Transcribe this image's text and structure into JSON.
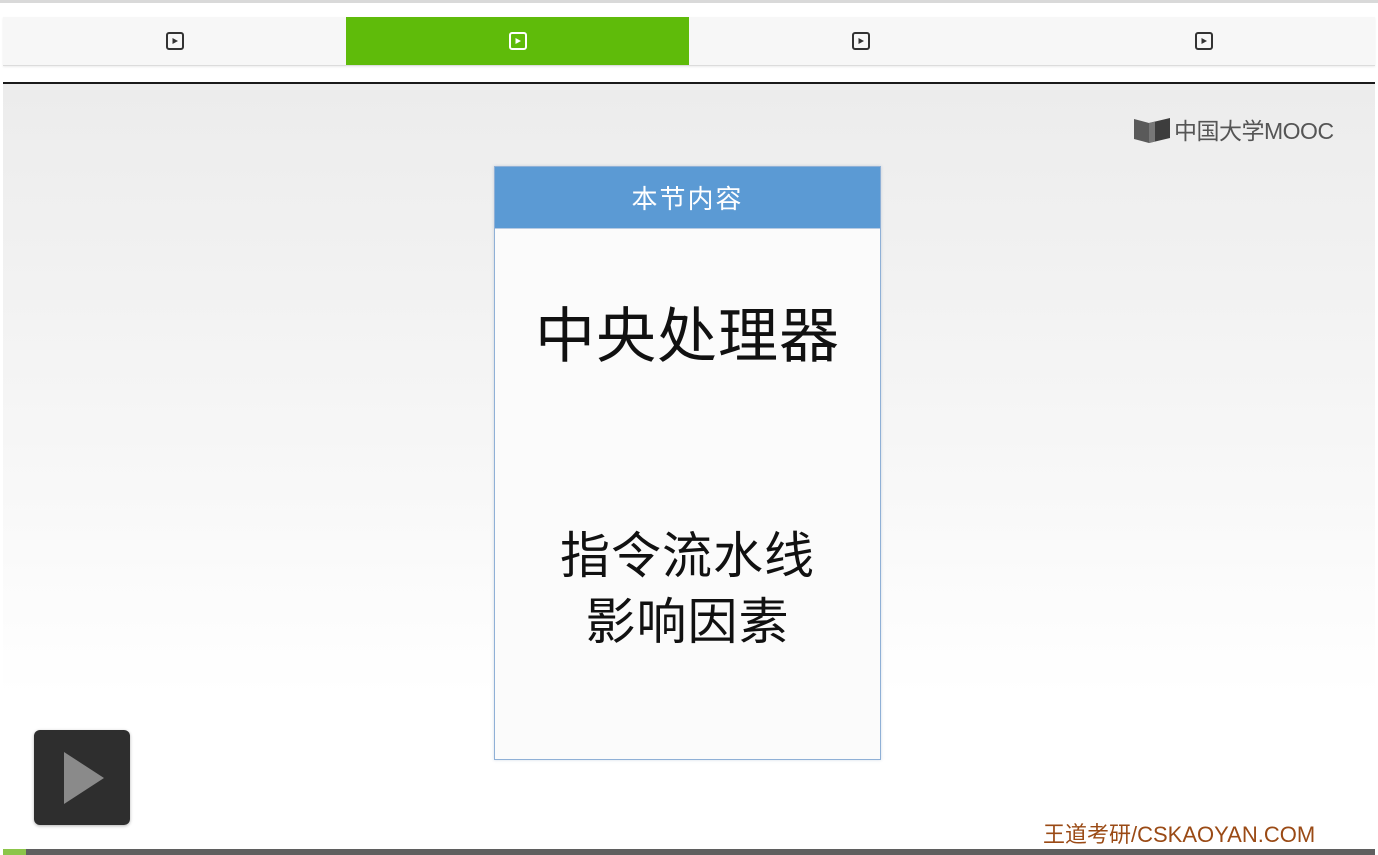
{
  "tabs": [
    {
      "label": "",
      "icon": "play-square-icon",
      "active": false
    },
    {
      "label": "",
      "icon": "play-square-icon",
      "active": true
    },
    {
      "label": "",
      "icon": "play-square-icon",
      "active": false
    },
    {
      "label": "",
      "icon": "play-square-icon",
      "active": false
    }
  ],
  "colors": {
    "active_tab": "#5fbb0a",
    "card_header": "#5b9ad4",
    "watermark": "#9a4a15",
    "progress_fill": "#8cc54a"
  },
  "logo": {
    "icon": "mooc-book-icon",
    "text": "中国大学MOOC"
  },
  "slide": {
    "header": "本节内容",
    "main_title": "中央处理器",
    "sub_line1": "指令流水线",
    "sub_line2": "影响因素"
  },
  "player": {
    "play_icon": "play-icon",
    "progress_percent": 1.7
  },
  "watermark": {
    "text": "王道考研/CSKAOYAN.COM"
  }
}
